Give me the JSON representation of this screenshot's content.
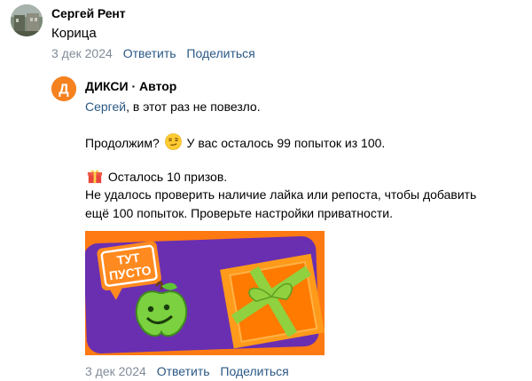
{
  "comment": {
    "author": "Сергей Рент",
    "text": "Корица",
    "date": "3 дек 2024",
    "reply_label": "Ответить",
    "share_label": "Поделиться"
  },
  "reply": {
    "author": "ДИКСИ",
    "separator": " · ",
    "role": "Автор",
    "logo_letter": "Д",
    "mention": "Сергей",
    "line1_rest": ", в этот раз не повезло.",
    "line2_a": "Продолжим?",
    "line2_b": "У вас осталось 99 попыток из 100.",
    "line3": "Осталось 10 призов.",
    "line4": "Не удалось проверить наличие лайка или репоста, чтобы добавить",
    "line5": "ещё 100 попыток. Проверьте настройки приватности.",
    "date": "3 дек 2024",
    "reply_label": "Ответить",
    "share_label": "Поделиться"
  },
  "promo_image": {
    "badge_line1": "ТУТ",
    "badge_line2": "ПУСТО"
  },
  "colors": {
    "link": "#2a5885",
    "meta": "#818c99",
    "brand_orange": "#f5821f",
    "promo_purple": "#6a2fb0",
    "promo_orange": "#ff7a12"
  },
  "icons": [
    "user-avatar",
    "dixy-logo",
    "smirk-emoji-icon",
    "gift-emoji-icon"
  ]
}
